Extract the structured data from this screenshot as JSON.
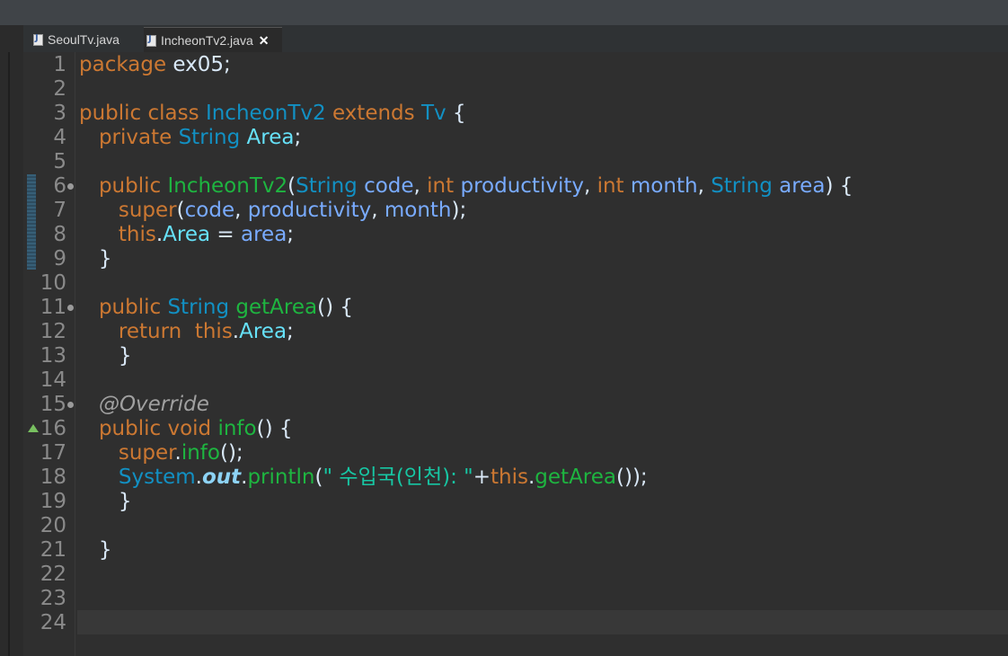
{
  "tabs": [
    {
      "label": "SeoulTv.java",
      "active": false
    },
    {
      "label": "IncheonTv2.java",
      "active": true,
      "close_glyph": "✕"
    }
  ],
  "editor": {
    "lines": [
      {
        "n": "1",
        "tokens": [
          [
            "kw",
            "package"
          ],
          [
            "pl",
            " ex05;"
          ]
        ]
      },
      {
        "n": "2",
        "tokens": []
      },
      {
        "n": "3",
        "tokens": [
          [
            "kw",
            "public"
          ],
          [
            "pl",
            " "
          ],
          [
            "kw",
            "class"
          ],
          [
            "pl",
            " "
          ],
          [
            "ty",
            "IncheonTv2"
          ],
          [
            "pl",
            " "
          ],
          [
            "kw",
            "extends"
          ],
          [
            "pl",
            " "
          ],
          [
            "ty",
            "Tv"
          ],
          [
            "pl",
            " {"
          ]
        ]
      },
      {
        "n": "4",
        "tokens": [
          [
            "pl",
            "   "
          ],
          [
            "kw",
            "private"
          ],
          [
            "pl",
            " "
          ],
          [
            "ty",
            "String"
          ],
          [
            "pl",
            " "
          ],
          [
            "fld",
            "Area"
          ],
          [
            "pl",
            ";"
          ]
        ]
      },
      {
        "n": "5",
        "tokens": []
      },
      {
        "n": "6",
        "fold": true,
        "tokens": [
          [
            "pl",
            "   "
          ],
          [
            "kw",
            "public"
          ],
          [
            "pl",
            " "
          ],
          [
            "fn",
            "IncheonTv2"
          ],
          [
            "pl",
            "("
          ],
          [
            "ty",
            "String"
          ],
          [
            "pl",
            " "
          ],
          [
            "var",
            "code"
          ],
          [
            "pl",
            ", "
          ],
          [
            "kw",
            "int"
          ],
          [
            "pl",
            " "
          ],
          [
            "var",
            "productivity"
          ],
          [
            "pl",
            ", "
          ],
          [
            "kw",
            "int"
          ],
          [
            "pl",
            " "
          ],
          [
            "var",
            "month"
          ],
          [
            "pl",
            ", "
          ],
          [
            "ty",
            "String"
          ],
          [
            "pl",
            " "
          ],
          [
            "var",
            "area"
          ],
          [
            "pl",
            ") {"
          ]
        ]
      },
      {
        "n": "7",
        "tokens": [
          [
            "pl",
            "      "
          ],
          [
            "kw",
            "super"
          ],
          [
            "pl",
            "("
          ],
          [
            "var",
            "code"
          ],
          [
            "pl",
            ", "
          ],
          [
            "var",
            "productivity"
          ],
          [
            "pl",
            ", "
          ],
          [
            "var",
            "month"
          ],
          [
            "pl",
            ");"
          ]
        ]
      },
      {
        "n": "8",
        "tokens": [
          [
            "pl",
            "      "
          ],
          [
            "kw",
            "this"
          ],
          [
            "pl",
            "."
          ],
          [
            "fld",
            "Area"
          ],
          [
            "pl",
            " = "
          ],
          [
            "var",
            "area"
          ],
          [
            "pl",
            ";"
          ]
        ]
      },
      {
        "n": "9",
        "tokens": [
          [
            "pl",
            "   }"
          ]
        ]
      },
      {
        "n": "10",
        "tokens": []
      },
      {
        "n": "11",
        "fold": true,
        "tokens": [
          [
            "pl",
            "   "
          ],
          [
            "kw",
            "public"
          ],
          [
            "pl",
            " "
          ],
          [
            "ty",
            "String"
          ],
          [
            "pl",
            " "
          ],
          [
            "fn",
            "getArea"
          ],
          [
            "pl",
            "() {"
          ]
        ]
      },
      {
        "n": "12",
        "tokens": [
          [
            "pl",
            "      "
          ],
          [
            "kw",
            "return"
          ],
          [
            "pl",
            "  "
          ],
          [
            "kw",
            "this"
          ],
          [
            "pl",
            "."
          ],
          [
            "fld",
            "Area"
          ],
          [
            "pl",
            ";"
          ]
        ]
      },
      {
        "n": "13",
        "tokens": [
          [
            "pl",
            "      }"
          ]
        ]
      },
      {
        "n": "14",
        "tokens": []
      },
      {
        "n": "15",
        "fold": true,
        "tokens": [
          [
            "pl",
            "   "
          ],
          [
            "ann",
            "@Override"
          ]
        ]
      },
      {
        "n": "16",
        "warn": true,
        "tokens": [
          [
            "pl",
            "   "
          ],
          [
            "kw",
            "public"
          ],
          [
            "pl",
            " "
          ],
          [
            "kw",
            "void"
          ],
          [
            "pl",
            " "
          ],
          [
            "fn",
            "info"
          ],
          [
            "pl",
            "() {"
          ]
        ]
      },
      {
        "n": "17",
        "tokens": [
          [
            "pl",
            "      "
          ],
          [
            "kw",
            "super"
          ],
          [
            "pl",
            "."
          ],
          [
            "fn",
            "info"
          ],
          [
            "pl",
            "();"
          ]
        ]
      },
      {
        "n": "18",
        "tokens": [
          [
            "pl",
            "      "
          ],
          [
            "nm",
            "System"
          ],
          [
            "pl",
            "."
          ],
          [
            "stat",
            "out"
          ],
          [
            "pl",
            "."
          ],
          [
            "fn",
            "println"
          ],
          [
            "pl",
            "("
          ],
          [
            "str",
            "\" 수입국(인천): \""
          ],
          [
            "pl",
            "+"
          ],
          [
            "kw",
            "this"
          ],
          [
            "pl",
            "."
          ],
          [
            "fn",
            "getArea"
          ],
          [
            "pl",
            "());"
          ]
        ]
      },
      {
        "n": "19",
        "tokens": [
          [
            "pl",
            "      }"
          ]
        ]
      },
      {
        "n": "20",
        "tokens": []
      },
      {
        "n": "21",
        "tokens": [
          [
            "pl",
            "   }"
          ]
        ]
      },
      {
        "n": "22",
        "tokens": []
      },
      {
        "n": "23",
        "tokens": []
      },
      {
        "n": "24",
        "tokens": []
      }
    ]
  }
}
